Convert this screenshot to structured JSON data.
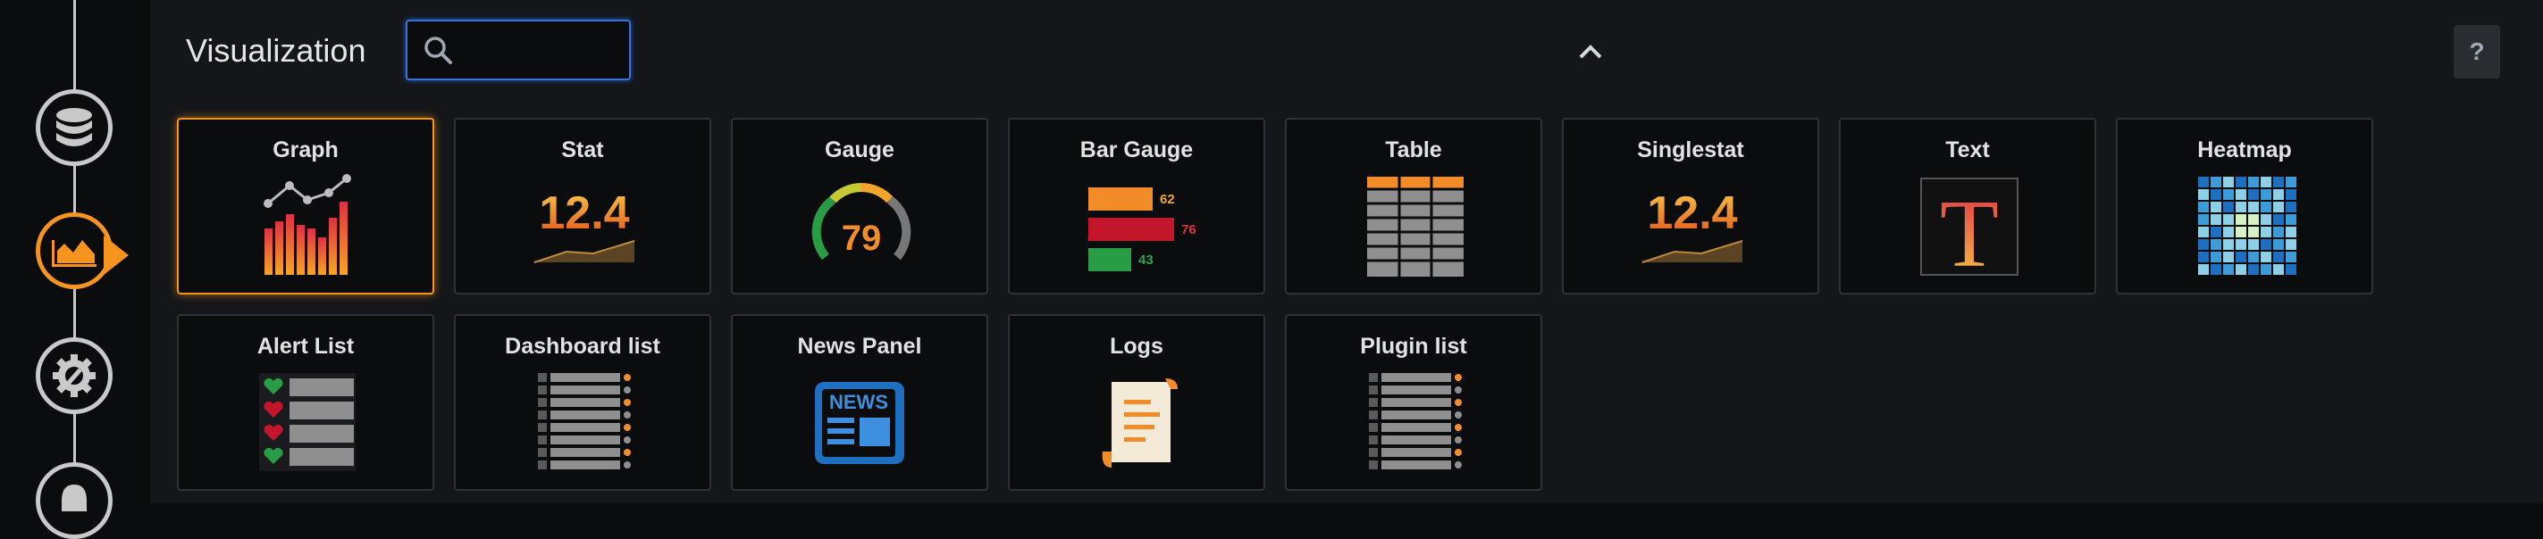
{
  "header": {
    "title": "Visualization",
    "search_value": "",
    "help_label": "?"
  },
  "rail": {
    "steps": [
      {
        "icon": "database-icon"
      },
      {
        "icon": "area-chart-icon",
        "active": true
      },
      {
        "icon": "gear-icon"
      },
      {
        "icon": "bell-icon"
      }
    ]
  },
  "tiles": [
    {
      "label": "Graph",
      "icon": "graph-icon",
      "selected": true
    },
    {
      "label": "Stat",
      "icon": "stat-icon",
      "value": "12.4"
    },
    {
      "label": "Gauge",
      "icon": "gauge-icon",
      "value": "79"
    },
    {
      "label": "Bar Gauge",
      "icon": "bar-gauge-icon",
      "values": [
        "62",
        "76",
        "43"
      ]
    },
    {
      "label": "Table",
      "icon": "table-icon"
    },
    {
      "label": "Singlestat",
      "icon": "singlestat-icon",
      "value": "12.4"
    },
    {
      "label": "Text",
      "icon": "text-icon",
      "glyph": "T"
    },
    {
      "label": "Heatmap",
      "icon": "heatmap-icon"
    },
    {
      "label": "Alert List",
      "icon": "alert-list-icon"
    },
    {
      "label": "Dashboard list",
      "icon": "dashboard-list-icon"
    },
    {
      "label": "News Panel",
      "icon": "news-icon",
      "badge": "NEWS"
    },
    {
      "label": "Logs",
      "icon": "logs-icon"
    },
    {
      "label": "Plugin list",
      "icon": "plugin-list-icon"
    }
  ],
  "colors": {
    "accent": "#f7941d",
    "focus": "#3d71d9",
    "red": "#e02f44",
    "green": "#299c46"
  }
}
